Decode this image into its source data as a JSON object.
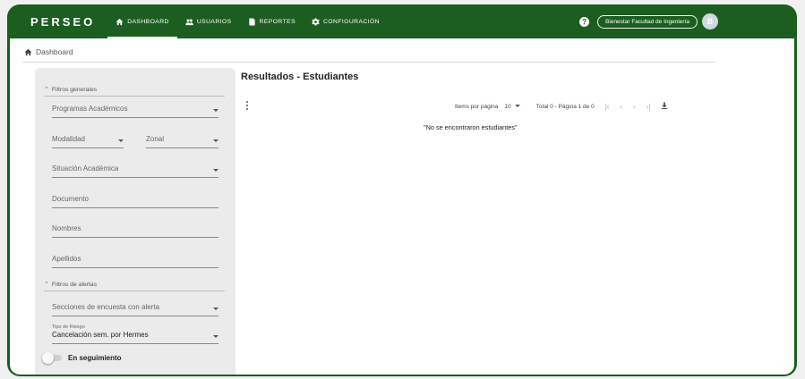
{
  "app": {
    "brand": "PERSEO",
    "nav": [
      {
        "label": "DASHBOARD",
        "icon": "home-icon"
      },
      {
        "label": "USUARIOS",
        "icon": "users-icon"
      },
      {
        "label": "REPORTES",
        "icon": "report-icon"
      },
      {
        "label": "CONFIGURACIÓN",
        "icon": "gear-icon"
      }
    ],
    "user_chip": "Bienestar Facultad de Ingeniería",
    "avatar_initial": "B",
    "accent": "#1b5e20"
  },
  "breadcrumb": "Dashboard",
  "filters": {
    "general_title": "Filtros generales",
    "programas": "Programas Académicos",
    "modalidad": "Modalidad",
    "zonal": "Zonal",
    "situacion": "Situación Académica",
    "documento": "Documento",
    "nombres": "Nombres",
    "apellidos": "Apellidos",
    "alertas_title": "Filtros de alertas",
    "secciones": "Secciones de encuesta con alerta",
    "tipo_riesgo_label": "Tipo de Riesgo",
    "tipo_riesgo_value": "Cancelación sem. por Hermes",
    "seguimiento": "En seguimiento"
  },
  "results": {
    "title": "Resultados - Estudiantes",
    "items_label": "Items por página",
    "items_value": "10",
    "range": "Total 0 - Página 1 de 0",
    "empty": "\"No se encontraron estudiantes\""
  }
}
